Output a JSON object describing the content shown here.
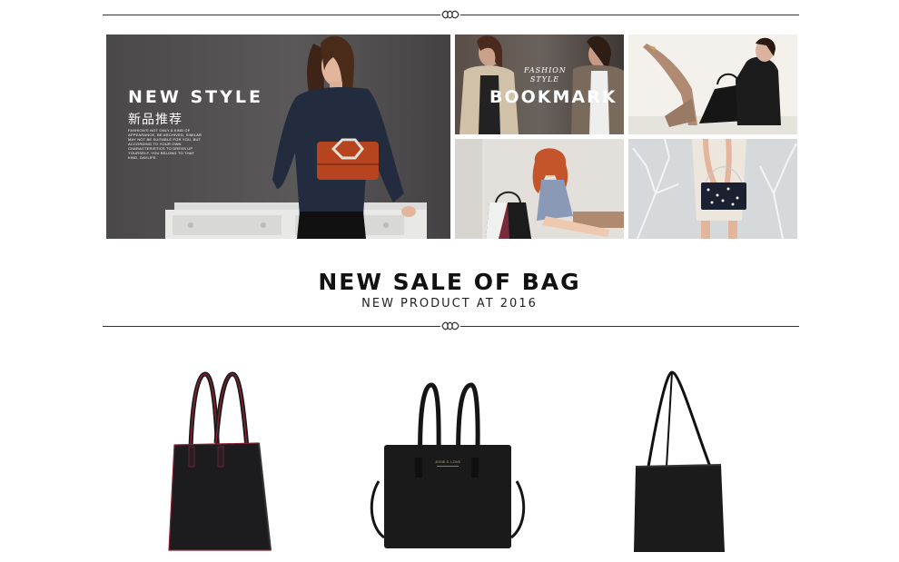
{
  "banner": {
    "main": {
      "title": "NEW STYLE",
      "subtitle_cn": "新品推荐",
      "small_text": "FASHION'S NOT ONLY A KIND OF APPEARANCE, BE ARCHIVED, SIMILAR MAY NOT BE SUITABLE FOR YOU, BUT ACCORDING TO YOUR OWN CHARACTERISTICS TO DRESS UP YOURSELF, YOU BELONG TO THAT KIND, DAYLIFE."
    },
    "bookmark": {
      "tag_line1": "FASHION",
      "tag_line2": "STYLE",
      "title": "BOOKMARK"
    }
  },
  "section": {
    "title": "NEW SALE OF BAG",
    "subtitle": "NEW PRODUCT AT 2016"
  },
  "products": [
    {
      "name": "tote-bag-red-trim"
    },
    {
      "name": "structured-handbag"
    },
    {
      "name": "slim-shoulder-tote",
      "brand_stamp": "JOSIE S. LOVE"
    }
  ],
  "colors": {
    "divider": "#333333",
    "hero_bg": "#4f4d4e",
    "clutch": "#b5441f",
    "bag": "#1a1a1a",
    "trim": "#8a2036"
  }
}
